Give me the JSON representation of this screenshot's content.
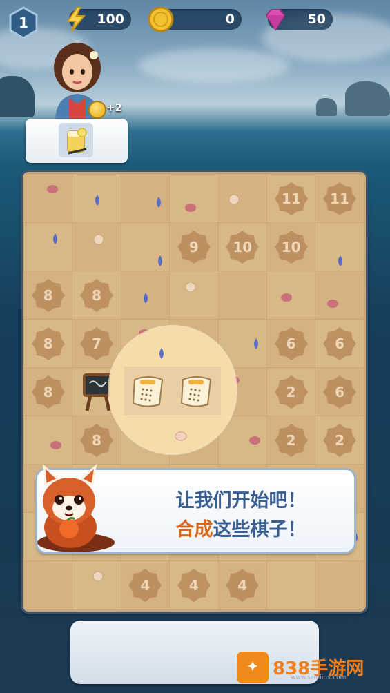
{
  "hud": {
    "level": "1",
    "energy": "100",
    "coins": "0",
    "gems": "50",
    "energy_icon": "lightning-icon",
    "coin_icon": "coin-icon",
    "gem_icon": "gem-icon"
  },
  "order": {
    "reward": "+2",
    "item_icon": "lemonade-icon"
  },
  "board": {
    "rows": [
      [
        "",
        "",
        "",
        "",
        "",
        "11",
        "11"
      ],
      [
        "",
        "",
        "",
        "9",
        "10",
        "10",
        ""
      ],
      [
        "8",
        "8",
        "",
        "",
        "",
        "",
        ""
      ],
      [
        "8",
        "7",
        "",
        "",
        "",
        "6",
        "6"
      ],
      [
        "8",
        "",
        "",
        "",
        "",
        "2",
        "6"
      ],
      [
        "",
        "8",
        "",
        "",
        "",
        "2",
        "2"
      ],
      [
        "",
        "",
        "",
        "",
        "",
        "",
        ""
      ],
      [
        "",
        "",
        "",
        "",
        "",
        "",
        ""
      ],
      [
        "",
        "",
        "4",
        "4",
        "4",
        "",
        ""
      ]
    ],
    "highlighted_items": [
      "recipe-scroll-icon",
      "recipe-scroll-icon"
    ],
    "easel_icon": "easel-icon"
  },
  "dialog": {
    "line1": "让我们开始吧！",
    "line2_highlight": "合成",
    "line2_rest": "这些棋子！",
    "speaker_icon": "red-panda-icon"
  },
  "watermark": {
    "text": "838手游网",
    "url": "www.szmiinx.com"
  },
  "colors": {
    "accent_text": "#3a5f93",
    "highlight_text": "#d9661b",
    "board_sand": "#d9b887",
    "lock_tile": "#b88a5c"
  }
}
